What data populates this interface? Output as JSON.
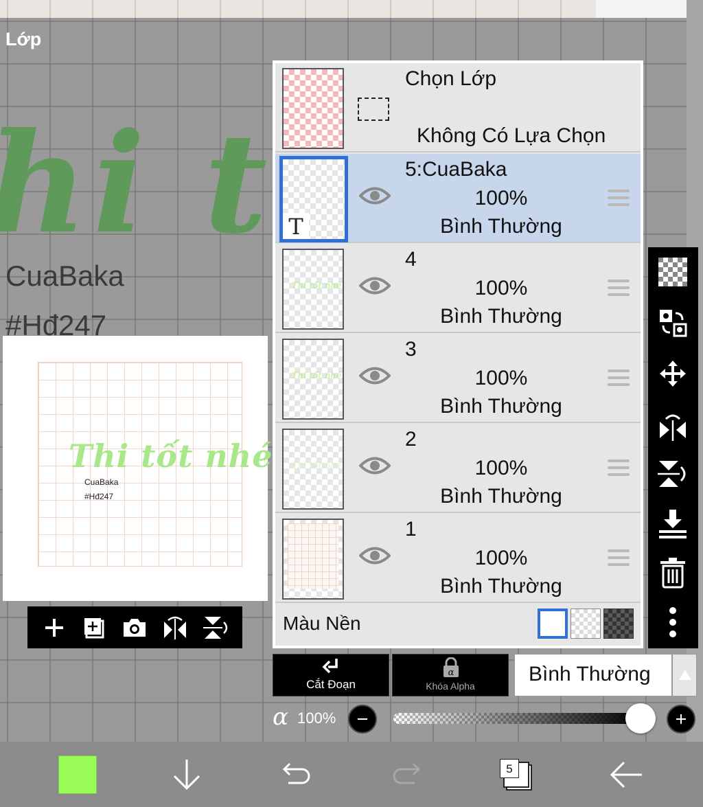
{
  "panel": {
    "title": "Lớp"
  },
  "canvas": {
    "script_text": "hi tốt",
    "name_text": "CuaBaka",
    "tag_text": "#Hđ247"
  },
  "preview": {
    "script_text": "Thi tốt nhé!!!",
    "name_text": "CuaBaka",
    "tag_text": "#Hđ247"
  },
  "selection_layer": {
    "title": "Chọn Lớp",
    "subtitle": "Không Có Lựa Chọn"
  },
  "layers": [
    {
      "name": "5:CuaBaka",
      "opacity": "100%",
      "mode": "Bình Thường",
      "selected": true,
      "type": "text"
    },
    {
      "name": "4",
      "opacity": "100%",
      "mode": "Bình Thường",
      "selected": false
    },
    {
      "name": "3",
      "opacity": "100%",
      "mode": "Bình Thường",
      "selected": false
    },
    {
      "name": "2",
      "opacity": "100%",
      "mode": "Bình Thường",
      "selected": false
    },
    {
      "name": "1",
      "opacity": "100%",
      "mode": "Bình Thường",
      "selected": false
    }
  ],
  "background_color": {
    "label": "Màu Nền",
    "options": [
      "white",
      "checker",
      "dark-checker"
    ],
    "selected": "white"
  },
  "blend": {
    "clip_label": "Cắt Đoạn",
    "alpha_lock_label": "Khóa Alpha",
    "mode_value": "Bình Thường"
  },
  "alpha": {
    "symbol": "α",
    "value_text": "100%",
    "value": 1.0
  },
  "bottom_bar": {
    "current_color": "#99fb55",
    "layer_count": "5"
  },
  "thumbnail_script": "Thi tốt nhé!"
}
